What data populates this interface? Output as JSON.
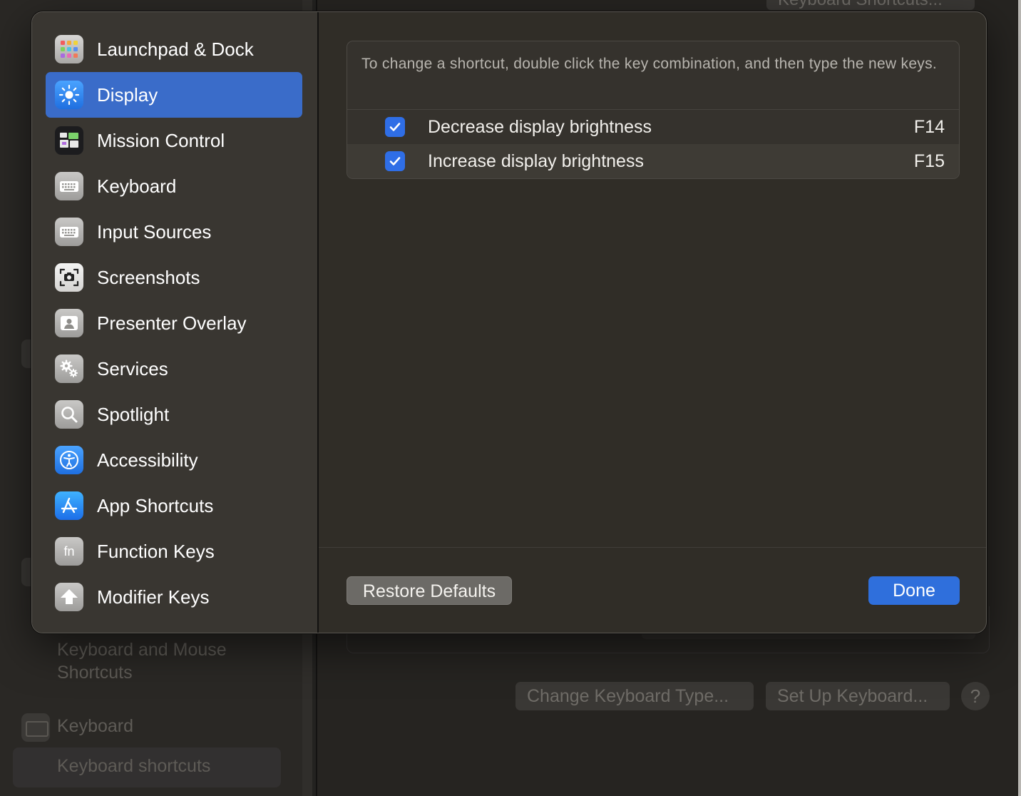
{
  "background": {
    "top_button_label": "Keyboard Shortcuts...",
    "nav_group_label": "Keyboard and Mouse Shortcuts",
    "sidebar_keyboard_label": "Keyboard",
    "sidebar_selected_label": "Keyboard shortcuts",
    "change_keyboard_type_label": "Change Keyboard Type...",
    "set_up_keyboard_label": "Set Up Keyboard...",
    "help_label": "?"
  },
  "sidebar": {
    "items": [
      {
        "label": "Launchpad & Dock",
        "icon": "launchpad-icon"
      },
      {
        "label": "Display",
        "icon": "display-brightness-icon",
        "selected": true
      },
      {
        "label": "Mission Control",
        "icon": "mission-control-icon"
      },
      {
        "label": "Keyboard",
        "icon": "keyboard-icon"
      },
      {
        "label": "Input Sources",
        "icon": "input-sources-icon"
      },
      {
        "label": "Screenshots",
        "icon": "screenshot-icon"
      },
      {
        "label": "Presenter Overlay",
        "icon": "presenter-overlay-icon"
      },
      {
        "label": "Services",
        "icon": "services-gear-icon"
      },
      {
        "label": "Spotlight",
        "icon": "spotlight-search-icon"
      },
      {
        "label": "Accessibility",
        "icon": "accessibility-icon"
      },
      {
        "label": "App Shortcuts",
        "icon": "app-store-icon"
      },
      {
        "label": "Function Keys",
        "icon": "fn-key-icon"
      },
      {
        "label": "Modifier Keys",
        "icon": "modifier-keys-icon"
      }
    ]
  },
  "content": {
    "instructions": "To change a shortcut, double click the key combination, and then type the new keys.",
    "shortcuts": [
      {
        "label": "Decrease display brightness",
        "key": "F14",
        "checked": true
      },
      {
        "label": "Increase display brightness",
        "key": "F15",
        "checked": true
      }
    ]
  },
  "footer": {
    "restore_label": "Restore Defaults",
    "done_label": "Done"
  },
  "colors": {
    "accent": "#2f6fdc",
    "selection": "#3a6cc9",
    "checkbox": "#2f6ee6"
  }
}
